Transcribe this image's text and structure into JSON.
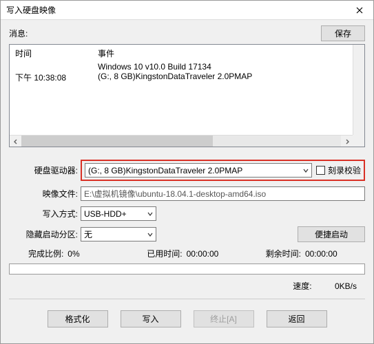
{
  "window": {
    "title": "写入硬盘映像"
  },
  "toolbar": {
    "info_label": "消息:",
    "save_label": "保存"
  },
  "list": {
    "header_time": "时间",
    "header_event": "事件",
    "rows": [
      {
        "time": "",
        "event": "Windows 10 v10.0 Build 17134"
      },
      {
        "time": "下午 10:38:08",
        "event": "(G:, 8 GB)KingstonDataTraveler 2.0PMAP"
      }
    ]
  },
  "form": {
    "drive_label": "硬盘驱动器:",
    "drive_value": "(G:, 8 GB)KingstonDataTraveler 2.0PMAP",
    "verify_label": "刻录校验",
    "image_label": "映像文件:",
    "image_value": "E:\\虚拟机镜像\\ubuntu-18.04.1-desktop-amd64.iso",
    "method_label": "写入方式:",
    "method_value": "USB-HDD+",
    "hidden_label": "隐藏启动分区:",
    "hidden_value": "无",
    "portable_label": "便捷启动"
  },
  "stats": {
    "done_label": "完成比例:",
    "done_value": "0%",
    "elapsed_label": "已用时间:",
    "elapsed_value": "00:00:00",
    "remain_label": "剩余时间:",
    "remain_value": "00:00:00",
    "speed_label": "速度:",
    "speed_value": "0KB/s"
  },
  "buttons": {
    "format": "格式化",
    "write": "写入",
    "abort": "终止[A]",
    "back": "返回"
  }
}
